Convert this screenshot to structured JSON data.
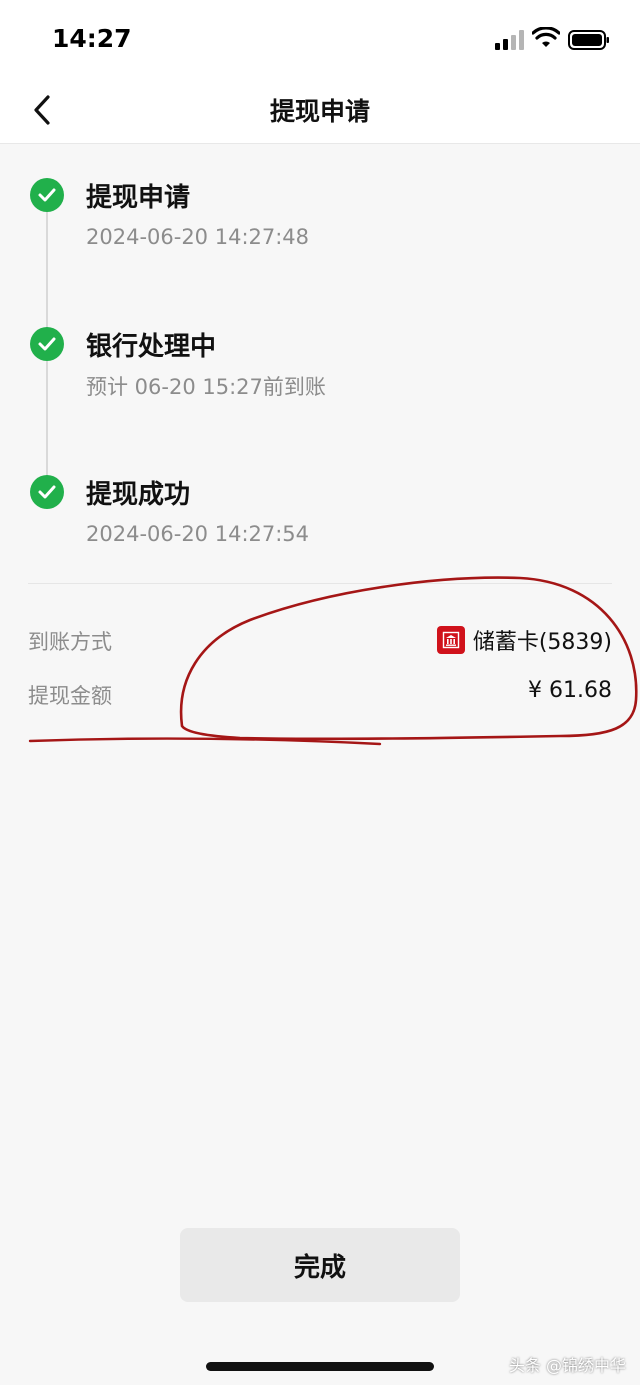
{
  "status_bar": {
    "time": "14:27"
  },
  "nav": {
    "title": "提现申请"
  },
  "timeline": {
    "steps": [
      {
        "title": "提现申请",
        "subtitle": "2024-06-20 14:27:48"
      },
      {
        "title": "银行处理中",
        "subtitle": "预计 06-20 15:27前到账"
      },
      {
        "title": "提现成功",
        "subtitle": "2024-06-20 14:27:54"
      }
    ]
  },
  "details": {
    "method_label": "到账方式",
    "method_value": "储蓄卡(5839)",
    "amount_label": "提现金额",
    "amount_value": "¥ 61.68"
  },
  "done_button": {
    "label": "完成"
  },
  "watermark": {
    "text": "头条 @锦绣中华"
  },
  "colors": {
    "success_green": "#21b04b",
    "bank_red": "#d0121b",
    "annotation_red": "#a51616"
  },
  "icons": {
    "back": "chevron-left-icon",
    "check": "check-icon",
    "bank": "bank-icon",
    "signal": "signal-icon",
    "wifi": "wifi-icon",
    "battery": "battery-icon"
  }
}
